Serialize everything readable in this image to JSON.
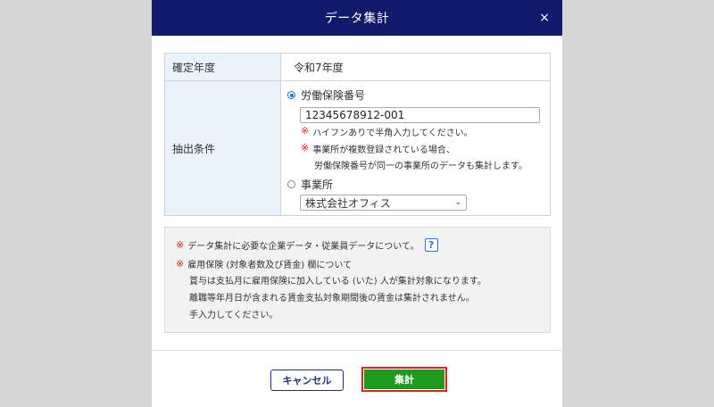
{
  "dialog": {
    "title": "データ集計",
    "close_glyph": "×"
  },
  "form": {
    "year_label": "確定年度",
    "year_value": "令和7年度",
    "condition_label": "抽出条件",
    "option_insurance": {
      "label": "労働保険番号",
      "selected": true,
      "input_value": "12345678912-001",
      "note1": "ハイフンありで半角入力してください。",
      "note2_line1": "事業所が複数登録されている場合、",
      "note2_line2": "労働保険番号が同一の事業所のデータも集計します。"
    },
    "option_office": {
      "label": "事業所",
      "selected": false,
      "select_value": "株式会社オフィス"
    }
  },
  "info": {
    "line1": "データ集計に必要な企業データ・従業員データについて。",
    "help_glyph": "?",
    "line2": "雇用保険 (対象者数及び賃金) 欄について",
    "line3": "賞与は支払月に雇用保険に加入している (いた) 人が集計対象になります。",
    "line4": "離職等年月日が含まれる賃金支払対象期間後の賃金は集計されません。",
    "line5": "手入力してください。",
    "asterisk": "※"
  },
  "buttons": {
    "cancel": "キャンセル",
    "submit": "集計"
  },
  "colors": {
    "header": "#121a6b",
    "submit": "#1e9b1e",
    "highlight": "#e02020"
  }
}
